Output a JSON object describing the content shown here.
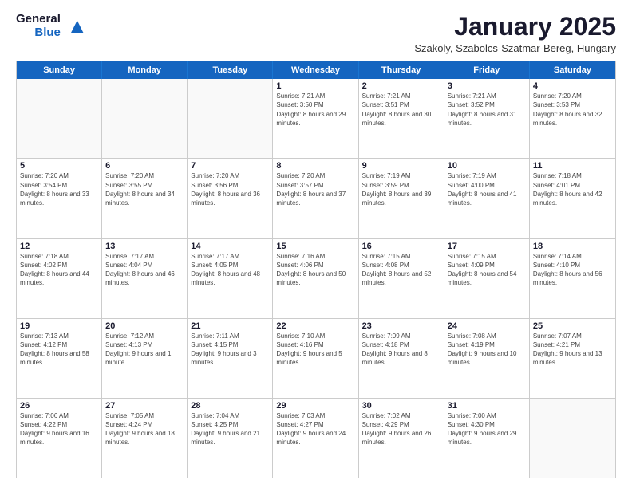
{
  "logo": {
    "general": "General",
    "blue": "Blue"
  },
  "title": "January 2025",
  "subtitle": "Szakoly, Szabolcs-Szatmar-Bereg, Hungary",
  "header_days": [
    "Sunday",
    "Monday",
    "Tuesday",
    "Wednesday",
    "Thursday",
    "Friday",
    "Saturday"
  ],
  "weeks": [
    [
      {
        "day": "",
        "info": ""
      },
      {
        "day": "",
        "info": ""
      },
      {
        "day": "",
        "info": ""
      },
      {
        "day": "1",
        "info": "Sunrise: 7:21 AM\nSunset: 3:50 PM\nDaylight: 8 hours and 29 minutes."
      },
      {
        "day": "2",
        "info": "Sunrise: 7:21 AM\nSunset: 3:51 PM\nDaylight: 8 hours and 30 minutes."
      },
      {
        "day": "3",
        "info": "Sunrise: 7:21 AM\nSunset: 3:52 PM\nDaylight: 8 hours and 31 minutes."
      },
      {
        "day": "4",
        "info": "Sunrise: 7:20 AM\nSunset: 3:53 PM\nDaylight: 8 hours and 32 minutes."
      }
    ],
    [
      {
        "day": "5",
        "info": "Sunrise: 7:20 AM\nSunset: 3:54 PM\nDaylight: 8 hours and 33 minutes."
      },
      {
        "day": "6",
        "info": "Sunrise: 7:20 AM\nSunset: 3:55 PM\nDaylight: 8 hours and 34 minutes."
      },
      {
        "day": "7",
        "info": "Sunrise: 7:20 AM\nSunset: 3:56 PM\nDaylight: 8 hours and 36 minutes."
      },
      {
        "day": "8",
        "info": "Sunrise: 7:20 AM\nSunset: 3:57 PM\nDaylight: 8 hours and 37 minutes."
      },
      {
        "day": "9",
        "info": "Sunrise: 7:19 AM\nSunset: 3:59 PM\nDaylight: 8 hours and 39 minutes."
      },
      {
        "day": "10",
        "info": "Sunrise: 7:19 AM\nSunset: 4:00 PM\nDaylight: 8 hours and 41 minutes."
      },
      {
        "day": "11",
        "info": "Sunrise: 7:18 AM\nSunset: 4:01 PM\nDaylight: 8 hours and 42 minutes."
      }
    ],
    [
      {
        "day": "12",
        "info": "Sunrise: 7:18 AM\nSunset: 4:02 PM\nDaylight: 8 hours and 44 minutes."
      },
      {
        "day": "13",
        "info": "Sunrise: 7:17 AM\nSunset: 4:04 PM\nDaylight: 8 hours and 46 minutes."
      },
      {
        "day": "14",
        "info": "Sunrise: 7:17 AM\nSunset: 4:05 PM\nDaylight: 8 hours and 48 minutes."
      },
      {
        "day": "15",
        "info": "Sunrise: 7:16 AM\nSunset: 4:06 PM\nDaylight: 8 hours and 50 minutes."
      },
      {
        "day": "16",
        "info": "Sunrise: 7:15 AM\nSunset: 4:08 PM\nDaylight: 8 hours and 52 minutes."
      },
      {
        "day": "17",
        "info": "Sunrise: 7:15 AM\nSunset: 4:09 PM\nDaylight: 8 hours and 54 minutes."
      },
      {
        "day": "18",
        "info": "Sunrise: 7:14 AM\nSunset: 4:10 PM\nDaylight: 8 hours and 56 minutes."
      }
    ],
    [
      {
        "day": "19",
        "info": "Sunrise: 7:13 AM\nSunset: 4:12 PM\nDaylight: 8 hours and 58 minutes."
      },
      {
        "day": "20",
        "info": "Sunrise: 7:12 AM\nSunset: 4:13 PM\nDaylight: 9 hours and 1 minute."
      },
      {
        "day": "21",
        "info": "Sunrise: 7:11 AM\nSunset: 4:15 PM\nDaylight: 9 hours and 3 minutes."
      },
      {
        "day": "22",
        "info": "Sunrise: 7:10 AM\nSunset: 4:16 PM\nDaylight: 9 hours and 5 minutes."
      },
      {
        "day": "23",
        "info": "Sunrise: 7:09 AM\nSunset: 4:18 PM\nDaylight: 9 hours and 8 minutes."
      },
      {
        "day": "24",
        "info": "Sunrise: 7:08 AM\nSunset: 4:19 PM\nDaylight: 9 hours and 10 minutes."
      },
      {
        "day": "25",
        "info": "Sunrise: 7:07 AM\nSunset: 4:21 PM\nDaylight: 9 hours and 13 minutes."
      }
    ],
    [
      {
        "day": "26",
        "info": "Sunrise: 7:06 AM\nSunset: 4:22 PM\nDaylight: 9 hours and 16 minutes."
      },
      {
        "day": "27",
        "info": "Sunrise: 7:05 AM\nSunset: 4:24 PM\nDaylight: 9 hours and 18 minutes."
      },
      {
        "day": "28",
        "info": "Sunrise: 7:04 AM\nSunset: 4:25 PM\nDaylight: 9 hours and 21 minutes."
      },
      {
        "day": "29",
        "info": "Sunrise: 7:03 AM\nSunset: 4:27 PM\nDaylight: 9 hours and 24 minutes."
      },
      {
        "day": "30",
        "info": "Sunrise: 7:02 AM\nSunset: 4:29 PM\nDaylight: 9 hours and 26 minutes."
      },
      {
        "day": "31",
        "info": "Sunrise: 7:00 AM\nSunset: 4:30 PM\nDaylight: 9 hours and 29 minutes."
      },
      {
        "day": "",
        "info": ""
      }
    ]
  ]
}
